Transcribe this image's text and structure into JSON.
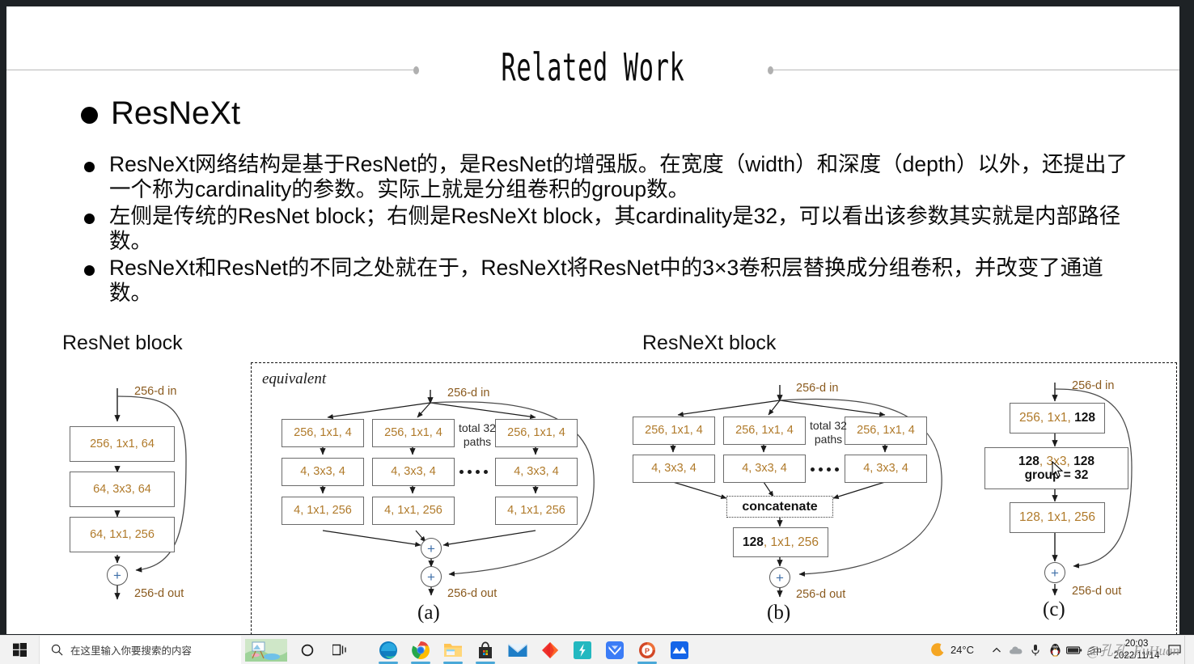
{
  "slide": {
    "title": "Related Work",
    "heading": "ResNeXt",
    "bullets": [
      "ResNeXt网络结构是基于ResNet的，是ResNet的增强版。在宽度（width）和深度（depth）以外，还提出了一个称为cardinality的参数。实际上就是分组卷积的group数。",
      "左侧是传统的ResNet block；右侧是ResNeXt block，其cardinality是32，可以看出该参数其实就是内部路径数。",
      "ResNeXt和ResNet的不同之处就在于，ResNeXt将ResNet中的3×3卷积层替换成分组卷积，并改变了通道数。"
    ],
    "fig_labels": {
      "resnet": "ResNet block",
      "resnext": "ResNeXt block"
    }
  },
  "figure": {
    "equivalent_note": "equivalent",
    "in_label": "256-d in",
    "out_label": "256-d out",
    "plus_symbol": "+",
    "total_paths": "total 32\npaths",
    "total_paths_line1": "total 32",
    "total_paths_line2": "paths",
    "concatenate": "concatenate",
    "captions": {
      "a": "(a)",
      "b": "(b)",
      "c": "(c)"
    },
    "resnet_block": {
      "boxes": [
        "256, 1x1, 64",
        "64, 3x3, 64",
        "64, 1x1, 256"
      ]
    },
    "panel_a": {
      "row1": [
        "256, 1x1, 4",
        "256, 1x1, 4",
        "256, 1x1, 4"
      ],
      "row2": [
        "4, 3x3, 4",
        "4, 3x3, 4",
        "4, 3x3, 4"
      ],
      "row3": [
        "4, 1x1, 256",
        "4, 1x1, 256",
        "4, 1x1, 256"
      ]
    },
    "panel_b": {
      "row1": [
        "256, 1x1, 4",
        "256, 1x1, 4",
        "256, 1x1, 4"
      ],
      "row2": [
        "4, 3x3, 4",
        "4, 3x3, 4",
        "4, 3x3, 4"
      ],
      "merge_box_bold": "128",
      "merge_box_rest": ", 1x1, 256"
    },
    "panel_c": {
      "box1_plain": "256, 1x1, ",
      "box1_bold": "128",
      "box2_line1_bold_a": "128",
      "box2_line1_plain": ", 3x3, ",
      "box2_line1_bold_b": "128",
      "box2_line2": "group = 32",
      "box3": "128, 1x1, 256"
    }
  },
  "taskbar": {
    "search_placeholder": "在这里输入你要搜索的内容",
    "weather_temp": "24°C",
    "clock_time": "20:03",
    "clock_date": "2022/11/14",
    "watermark": "@孔孔_FuHuan",
    "apps": [
      "microsoft-edge",
      "google-chrome",
      "file-explorer",
      "microsoft-store",
      "mail",
      "red-diamond-app",
      "snipaste",
      "blue-bird-app",
      "microsoft-powerpoint",
      "blue-wave-app"
    ]
  },
  "colors": {
    "slide_bg": "#ffffff",
    "desktop_border": "#1e2225",
    "text": "#0a0a0a",
    "diagram_number": "#b07a2a",
    "diagram_stroke": "#6b6b6b",
    "plus_blue": "#3f6fa8",
    "taskbar_bg": "#f2f2f2"
  }
}
